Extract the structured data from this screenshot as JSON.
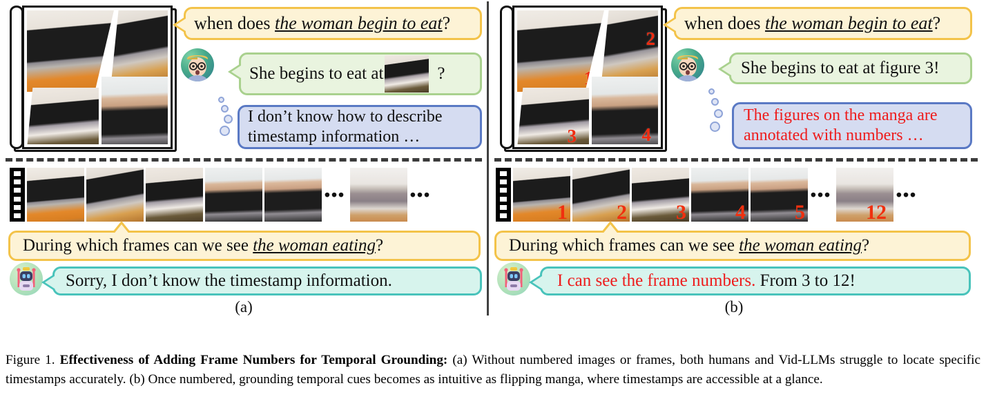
{
  "figure": {
    "label": "Figure 1.",
    "bold_title": "Effectiveness of Adding Frame Numbers for Temporal Grounding:",
    "body": " (a) Without numbered images or frames, both humans and Vid-LLMs struggle to locate specific timestamps accurately.  (b) Once numbered, grounding temporal cues becomes as intuitive as flipping manga, where timestamps are accessible at a glance."
  },
  "colors": {
    "yellow_fill": "#fdf3d6",
    "yellow_border": "#f3c34a",
    "green_fill": "#e9f4df",
    "green_border": "#a9d18e",
    "blue_fill": "#d5dcf1",
    "blue_border": "#5a79c4",
    "teal_fill": "#d7f4ed",
    "teal_border": "#49c3bb",
    "number_red": "#f0300f",
    "text_red": "#ee1c1c",
    "divider": "#3c3c3c"
  },
  "panel_a": {
    "sub_label": "(a)",
    "manga": {
      "panel_numbers": [
        "",
        "",
        "",
        ""
      ]
    },
    "question_bubble": {
      "prefix": "when does ",
      "emphasis": "the woman begin to eat",
      "suffix": "?"
    },
    "human_answer_bubble": {
      "prefix": "She begins to eat at",
      "inline_image": "manga-thumbnail",
      "suffix": "?"
    },
    "human_thought_bubble": {
      "line1": "I don’t know how to describe",
      "line2": "timestamp information …"
    },
    "filmstrip": {
      "frame_numbers": [
        "",
        "",
        "",
        "",
        "",
        ""
      ],
      "ellipsis": "•••"
    },
    "frames_question_bubble": {
      "prefix": "During which frames can we see ",
      "emphasis": "the woman eating",
      "suffix": "?"
    },
    "robot_answer_bubble": {
      "text": "Sorry, I don’t know the timestamp information."
    }
  },
  "panel_b": {
    "sub_label": "(b)",
    "manga": {
      "panel_numbers": [
        "1",
        "2",
        "3",
        "4"
      ]
    },
    "question_bubble": {
      "prefix": "when does ",
      "emphasis": "the woman begin to eat",
      "suffix": "?"
    },
    "human_answer_bubble": {
      "text": "She begins to eat at figure 3!"
    },
    "human_thought_bubble": {
      "line1": "The figures on the manga are",
      "line2": "annotated with numbers …"
    },
    "filmstrip": {
      "frame_numbers": [
        "1",
        "2",
        "3",
        "4",
        "5",
        "12"
      ],
      "ellipsis": "•••"
    },
    "frames_question_bubble": {
      "prefix": "During which frames can we see ",
      "emphasis": "the woman eating",
      "suffix": "?"
    },
    "robot_answer_bubble": {
      "red_part": "I can see the frame numbers.",
      "black_part": " From 3 to 12!"
    }
  }
}
